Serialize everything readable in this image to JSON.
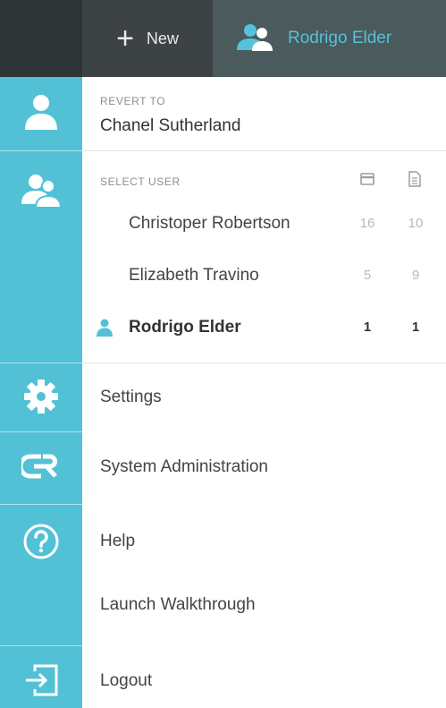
{
  "topbar": {
    "new_label": "New",
    "current_user": "Rodrigo Elder"
  },
  "revert": {
    "caption": "REVERT TO",
    "name": "Chanel Sutherland"
  },
  "select_user": {
    "caption": "SELECT USER",
    "columns": [
      "card-icon",
      "document-icon"
    ],
    "users": [
      {
        "name": "Christoper Robertson",
        "count1": "16",
        "count2": "10",
        "active": false
      },
      {
        "name": "Elizabeth Travino",
        "count1": "5",
        "count2": "9",
        "active": false
      },
      {
        "name": "Rodrigo Elder",
        "count1": "1",
        "count2": "1",
        "active": true
      }
    ]
  },
  "menu": {
    "settings": "Settings",
    "system_admin": "System Administration",
    "help": "Help",
    "walkthrough": "Launch Walkthrough",
    "logout": "Logout"
  },
  "colors": {
    "accent": "#52c1d6",
    "topbar": "#2f3436",
    "topbar_user": "#4a5a5d",
    "text": "#444444"
  }
}
